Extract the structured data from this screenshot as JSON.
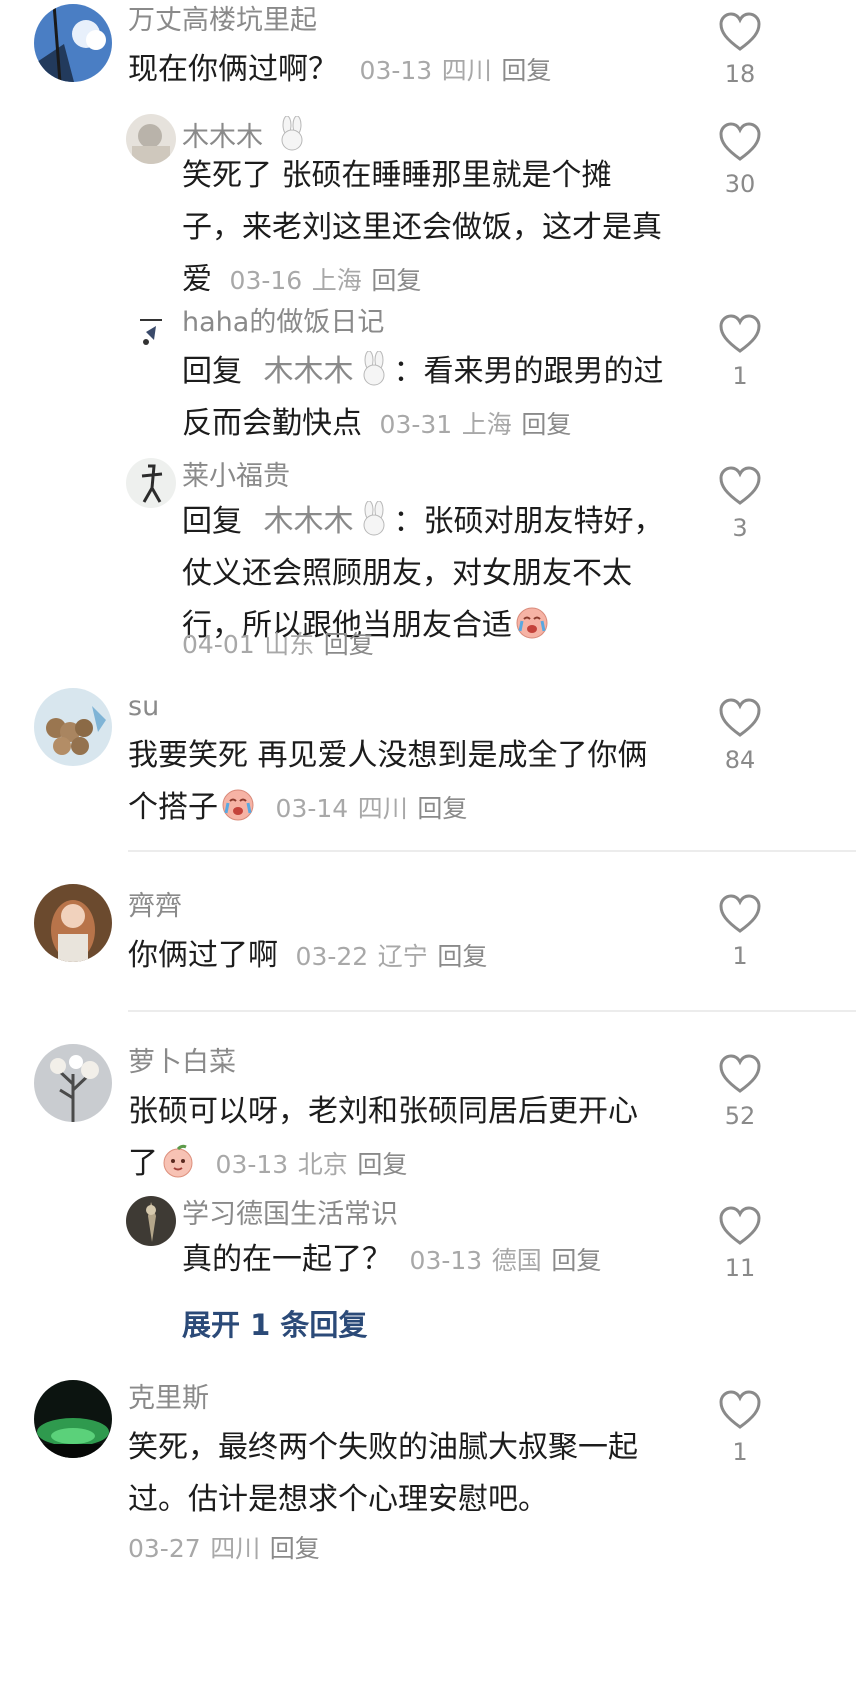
{
  "reply_label": "回复",
  "comments": [
    {
      "user": "万丈高楼坑里起",
      "text": "现在你俩过啊？",
      "date": "03-13",
      "location": "四川",
      "likes": "18",
      "replies": [
        {
          "user": "木木木",
          "text_lines": [
            "笑死了 张硕在睡睡那里就是个摊",
            "子，来老刘这里还会做饭，这才是真",
            "爱"
          ],
          "date": "03-16",
          "location": "上海",
          "likes": "30"
        },
        {
          "user": "haha的做饭日记",
          "reply_prefix": "回复",
          "mention": "木木木",
          "text_lines": [
            "：看来男的跟男的过",
            "反而会勤快点"
          ],
          "date": "03-31",
          "location": "上海",
          "likes": "1"
        },
        {
          "user": "莱小福贵",
          "reply_prefix": "回复",
          "mention": "木木木",
          "text_lines": [
            "：张硕对朋友特好，",
            "仗义还会照顾朋友，对女朋友不太",
            "行，所以跟他当朋友合适"
          ],
          "date": "04-01",
          "location": "山东",
          "likes": "3"
        }
      ]
    },
    {
      "user": "su",
      "text_lines": [
        "我要笑死 再见爱人没想到是成全了你俩",
        "个搭子"
      ],
      "date": "03-14",
      "location": "四川",
      "likes": "84"
    },
    {
      "user": "齊齊",
      "text": "你俩过了啊",
      "date": "03-22",
      "location": "辽宁",
      "likes": "1"
    },
    {
      "user": "萝卜白菜",
      "text_lines": [
        "张硕可以呀，老刘和张硕同居后更开心",
        "了"
      ],
      "date": "03-13",
      "location": "北京",
      "likes": "52",
      "replies": [
        {
          "user": "学习德国生活常识",
          "text": "真的在一起了？",
          "date": "03-13",
          "location": "德国",
          "likes": "11"
        }
      ],
      "expand_label": "展开 1 条回复"
    },
    {
      "user": "克里斯",
      "text_lines": [
        "笑死，最终两个失败的油腻大叔聚一起",
        "过。估计是想求个心理安慰吧。"
      ],
      "date": "03-27",
      "location": "四川",
      "likes": "1"
    }
  ],
  "colors": {
    "meta": "#a8a8a8",
    "name": "#8a8a8a",
    "expand": "#2b4a78"
  }
}
